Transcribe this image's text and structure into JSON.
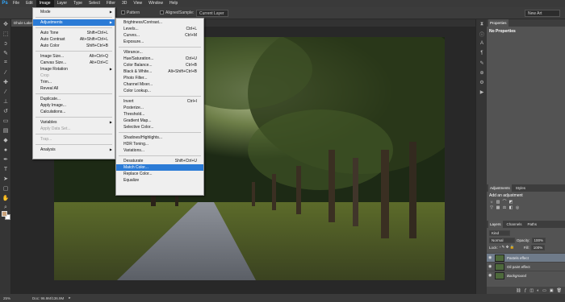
{
  "menubar": {
    "logo": "Ps",
    "items": [
      "File",
      "Edit",
      "Image",
      "Layer",
      "Type",
      "Select",
      "Filter",
      "3D",
      "View",
      "Window",
      "Help"
    ],
    "active_index": 2
  },
  "optbar": {
    "pattern_label": "Pattern",
    "aligned_label": "Aligned",
    "sample_label": "Sample:",
    "sample_value": "Current Layer",
    "workspace_value": "New Art"
  },
  "document": {
    "tab_title": "Dhule Lake road.jpg"
  },
  "status": {
    "zoom": "25%",
    "doc_info": "Doc: 96.9M/136.9M"
  },
  "image_menu": [
    {
      "label": "Mode",
      "shortcut": "",
      "submenu": true,
      "disabled": false,
      "highlight": false
    },
    {
      "sep": true
    },
    {
      "label": "Adjustments",
      "shortcut": "",
      "submenu": true,
      "disabled": false,
      "highlight": true
    },
    {
      "sep": true
    },
    {
      "label": "Auto Tone",
      "shortcut": "Shift+Ctrl+L",
      "submenu": false,
      "disabled": false,
      "highlight": false
    },
    {
      "label": "Auto Contrast",
      "shortcut": "Alt+Shift+Ctrl+L",
      "submenu": false,
      "disabled": false,
      "highlight": false
    },
    {
      "label": "Auto Color",
      "shortcut": "Shift+Ctrl+B",
      "submenu": false,
      "disabled": false,
      "highlight": false
    },
    {
      "sep": true
    },
    {
      "label": "Image Size...",
      "shortcut": "Alt+Ctrl+Q",
      "submenu": false,
      "disabled": false,
      "highlight": false
    },
    {
      "label": "Canvas Size...",
      "shortcut": "Alt+Ctrl+C",
      "submenu": false,
      "disabled": false,
      "highlight": false
    },
    {
      "label": "Image Rotation",
      "shortcut": "",
      "submenu": true,
      "disabled": false,
      "highlight": false
    },
    {
      "label": "Crop",
      "shortcut": "",
      "submenu": false,
      "disabled": true,
      "highlight": false
    },
    {
      "label": "Trim...",
      "shortcut": "",
      "submenu": false,
      "disabled": false,
      "highlight": false
    },
    {
      "label": "Reveal All",
      "shortcut": "",
      "submenu": false,
      "disabled": false,
      "highlight": false
    },
    {
      "sep": true
    },
    {
      "label": "Duplicate...",
      "shortcut": "",
      "submenu": false,
      "disabled": false,
      "highlight": false
    },
    {
      "label": "Apply Image...",
      "shortcut": "",
      "submenu": false,
      "disabled": false,
      "highlight": false
    },
    {
      "label": "Calculations...",
      "shortcut": "",
      "submenu": false,
      "disabled": false,
      "highlight": false
    },
    {
      "sep": true
    },
    {
      "label": "Variables",
      "shortcut": "",
      "submenu": true,
      "disabled": false,
      "highlight": false
    },
    {
      "label": "Apply Data Set...",
      "shortcut": "",
      "submenu": false,
      "disabled": true,
      "highlight": false
    },
    {
      "sep": true
    },
    {
      "label": "Trap...",
      "shortcut": "",
      "submenu": false,
      "disabled": true,
      "highlight": false
    },
    {
      "sep": true
    },
    {
      "label": "Analysis",
      "shortcut": "",
      "submenu": true,
      "disabled": false,
      "highlight": false
    }
  ],
  "adjustments_menu": [
    {
      "label": "Brightness/Contrast...",
      "shortcut": "",
      "disabled": false,
      "highlight": false
    },
    {
      "label": "Levels...",
      "shortcut": "Ctrl+L",
      "disabled": false,
      "highlight": false
    },
    {
      "label": "Curves...",
      "shortcut": "Ctrl+M",
      "disabled": false,
      "highlight": false
    },
    {
      "label": "Exposure...",
      "shortcut": "",
      "disabled": false,
      "highlight": false
    },
    {
      "sep": true
    },
    {
      "label": "Vibrance...",
      "shortcut": "",
      "disabled": false,
      "highlight": false
    },
    {
      "label": "Hue/Saturation...",
      "shortcut": "Ctrl+U",
      "disabled": false,
      "highlight": false
    },
    {
      "label": "Color Balance...",
      "shortcut": "Ctrl+B",
      "disabled": false,
      "highlight": false
    },
    {
      "label": "Black & White...",
      "shortcut": "Alt+Shift+Ctrl+B",
      "disabled": false,
      "highlight": false
    },
    {
      "label": "Photo Filter...",
      "shortcut": "",
      "disabled": false,
      "highlight": false
    },
    {
      "label": "Channel Mixer...",
      "shortcut": "",
      "disabled": false,
      "highlight": false
    },
    {
      "label": "Color Lookup...",
      "shortcut": "",
      "disabled": false,
      "highlight": false
    },
    {
      "sep": true
    },
    {
      "label": "Invert",
      "shortcut": "Ctrl+I",
      "disabled": false,
      "highlight": false
    },
    {
      "label": "Posterize...",
      "shortcut": "",
      "disabled": false,
      "highlight": false
    },
    {
      "label": "Threshold...",
      "shortcut": "",
      "disabled": false,
      "highlight": false
    },
    {
      "label": "Gradient Map...",
      "shortcut": "",
      "disabled": false,
      "highlight": false
    },
    {
      "label": "Selective Color...",
      "shortcut": "",
      "disabled": false,
      "highlight": false
    },
    {
      "sep": true
    },
    {
      "label": "Shadows/Highlights...",
      "shortcut": "",
      "disabled": false,
      "highlight": false
    },
    {
      "label": "HDR Toning...",
      "shortcut": "",
      "disabled": false,
      "highlight": false
    },
    {
      "label": "Variations...",
      "shortcut": "",
      "disabled": false,
      "highlight": false
    },
    {
      "sep": true
    },
    {
      "label": "Desaturate",
      "shortcut": "Shift+Ctrl+U",
      "disabled": false,
      "highlight": false
    },
    {
      "label": "Match Color...",
      "shortcut": "",
      "disabled": false,
      "highlight": true
    },
    {
      "label": "Replace Color...",
      "shortcut": "",
      "disabled": false,
      "highlight": false
    },
    {
      "label": "Equalize",
      "shortcut": "",
      "disabled": false,
      "highlight": false
    }
  ],
  "panels": {
    "properties_tab": "Properties",
    "properties_body": "No Properties",
    "adjustments_tabs": [
      "Adjustments",
      "Styles"
    ],
    "adjustments_title": "Add an adjustment",
    "layers_tabs": [
      "Layers",
      "Channels",
      "Paths"
    ],
    "kind_label": "Kind",
    "blend_mode": "Normal",
    "opacity_label": "Opacity:",
    "opacity_value": "100%",
    "lock_label": "Lock:",
    "fill_label": "Fill:",
    "fill_value": "100%",
    "layers": [
      {
        "name": "Pastels effect",
        "selected": true,
        "italic": false
      },
      {
        "name": "Oil paint effect",
        "selected": false,
        "italic": false
      },
      {
        "name": "Background",
        "selected": false,
        "italic": true
      }
    ]
  },
  "colors": {
    "highlight": "#2b7bd6",
    "selected_layer": "#6f7b8a"
  }
}
